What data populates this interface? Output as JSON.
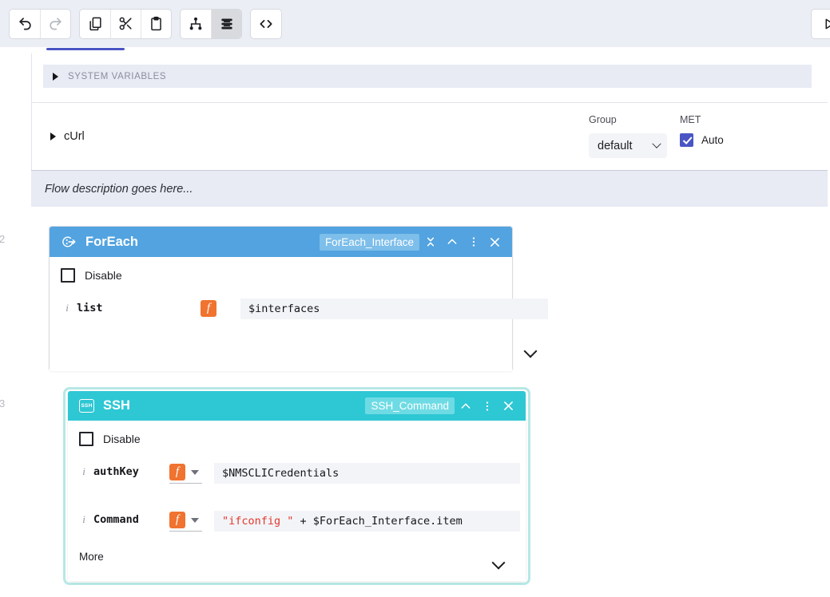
{
  "toolbar": {
    "groups": [
      {
        "name": "history",
        "buttons": [
          {
            "name": "undo-button",
            "icon": "undo-icon",
            "label": "Undo",
            "state": "enabled"
          },
          {
            "name": "redo-button",
            "icon": "redo-icon",
            "label": "Redo",
            "state": "disabled"
          }
        ]
      },
      {
        "name": "clipboard",
        "buttons": [
          {
            "name": "copy-button",
            "icon": "copy-icon",
            "label": "Copy",
            "state": "enabled"
          },
          {
            "name": "cut-button",
            "icon": "scissors-icon",
            "label": "Cut",
            "state": "enabled"
          },
          {
            "name": "paste-button",
            "icon": "clipboard-icon",
            "label": "Paste",
            "state": "enabled"
          }
        ]
      },
      {
        "name": "view-mode",
        "buttons": [
          {
            "name": "graph-view-button",
            "icon": "sitemap-icon",
            "label": "Graph view",
            "state": "enabled"
          },
          {
            "name": "list-view-button",
            "icon": "stacked-list-icon",
            "label": "List view",
            "state": "active"
          }
        ]
      },
      {
        "name": "code",
        "buttons": [
          {
            "name": "code-view-button",
            "icon": "code-brackets-icon",
            "label": "Code view",
            "state": "enabled"
          }
        ]
      }
    ],
    "run_button": {
      "name": "run-button",
      "icon": "play-icon",
      "label": "Run"
    }
  },
  "header_panel": {
    "system_variables": {
      "label": "SYSTEM VARIABLES",
      "expanded": false
    },
    "curl": {
      "label": "cUrl",
      "expanded": false
    },
    "group": {
      "caption": "Group",
      "value": "default",
      "options": [
        "default"
      ]
    },
    "met": {
      "caption": "MET",
      "checkbox_label": "Auto",
      "checked": true
    }
  },
  "flow_description": {
    "text": "Flow description goes here..."
  },
  "nodes": [
    {
      "step": "2",
      "name": "ForEach",
      "icon": "foreach-loop-icon",
      "instance_name": "ForEach_Interface",
      "accent": "#52a3e0",
      "chip_bg": "#7dbeea",
      "selected": false,
      "header_actions": [
        {
          "name": "collapse-all-icon",
          "glyph": "collapse"
        },
        {
          "name": "chevron-up-icon",
          "glyph": "chevron-up"
        },
        {
          "name": "more-options-icon",
          "glyph": "kebab"
        },
        {
          "name": "close-icon",
          "glyph": "close"
        }
      ],
      "disable": {
        "label": "Disable",
        "checked": false
      },
      "params": [
        {
          "name": "list",
          "mode": "function",
          "mode_badge": "f",
          "has_dropdown": false,
          "value": "$interfaces",
          "value_is_string": false
        }
      ],
      "more_label": null,
      "expand_icon": "chevron-down-icon"
    },
    {
      "step": "3",
      "name": "SSH",
      "icon": "ssh-terminal-icon",
      "instance_name": "SSH_Command",
      "accent": "#2ec7d4",
      "chip_bg": "#6edbe4",
      "selected": true,
      "header_actions": [
        {
          "name": "chevron-up-icon",
          "glyph": "chevron-up"
        },
        {
          "name": "more-options-icon",
          "glyph": "kebab"
        },
        {
          "name": "close-icon",
          "glyph": "close"
        }
      ],
      "disable": {
        "label": "Disable",
        "checked": false
      },
      "params": [
        {
          "name": "authKey",
          "mode": "function",
          "mode_badge": "f",
          "has_dropdown": true,
          "value": "$NMSCLICredentials",
          "value_is_string": false
        },
        {
          "name": "Command",
          "mode": "function",
          "mode_badge": "f",
          "has_dropdown": true,
          "value_string_part": "\"ifconfig \"",
          "value_rest": " + $ForEach_Interface.item",
          "value_is_string": true
        }
      ],
      "more_label": "More",
      "expand_icon": "chevron-down-icon"
    }
  ],
  "colors": {
    "toolbar_bg": "#eceef5",
    "tab_accent": "#4a55c4",
    "panel_band": "#e8eaf4",
    "foreach_blue": "#52a3e0",
    "ssh_teal": "#2ec7d4",
    "function_orange": "#f0732f",
    "string_red": "#e0382d",
    "input_bg": "#f3f4f7"
  }
}
